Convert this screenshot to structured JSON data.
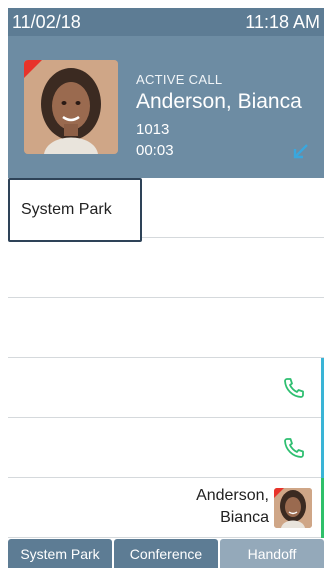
{
  "status": {
    "date": "11/02/18",
    "time": "11:18 AM"
  },
  "call": {
    "label": "ACTIVE CALL",
    "name": "Anderson, Bianca",
    "extension": "1013",
    "duration": "00:03",
    "direction_icon": "incoming-arrow-icon"
  },
  "line_keys": [
    {
      "label": "System Park"
    },
    {
      "label": ""
    },
    {
      "label": ""
    },
    {
      "icon": "phone-icon",
      "accent": "#3ab4d6"
    },
    {
      "icon": "phone-icon",
      "accent": "#3ab4d6"
    },
    {
      "contact_first": "Anderson,",
      "contact_last": "Bianca",
      "accent": "#2fc06a"
    }
  ],
  "softkeys": [
    {
      "label": "System Park"
    },
    {
      "label": "Conference"
    },
    {
      "label": "Handoff"
    }
  ],
  "colors": {
    "header": "#5d7c94",
    "panel": "#6d8ca3",
    "phone_green": "#2fbf71"
  }
}
